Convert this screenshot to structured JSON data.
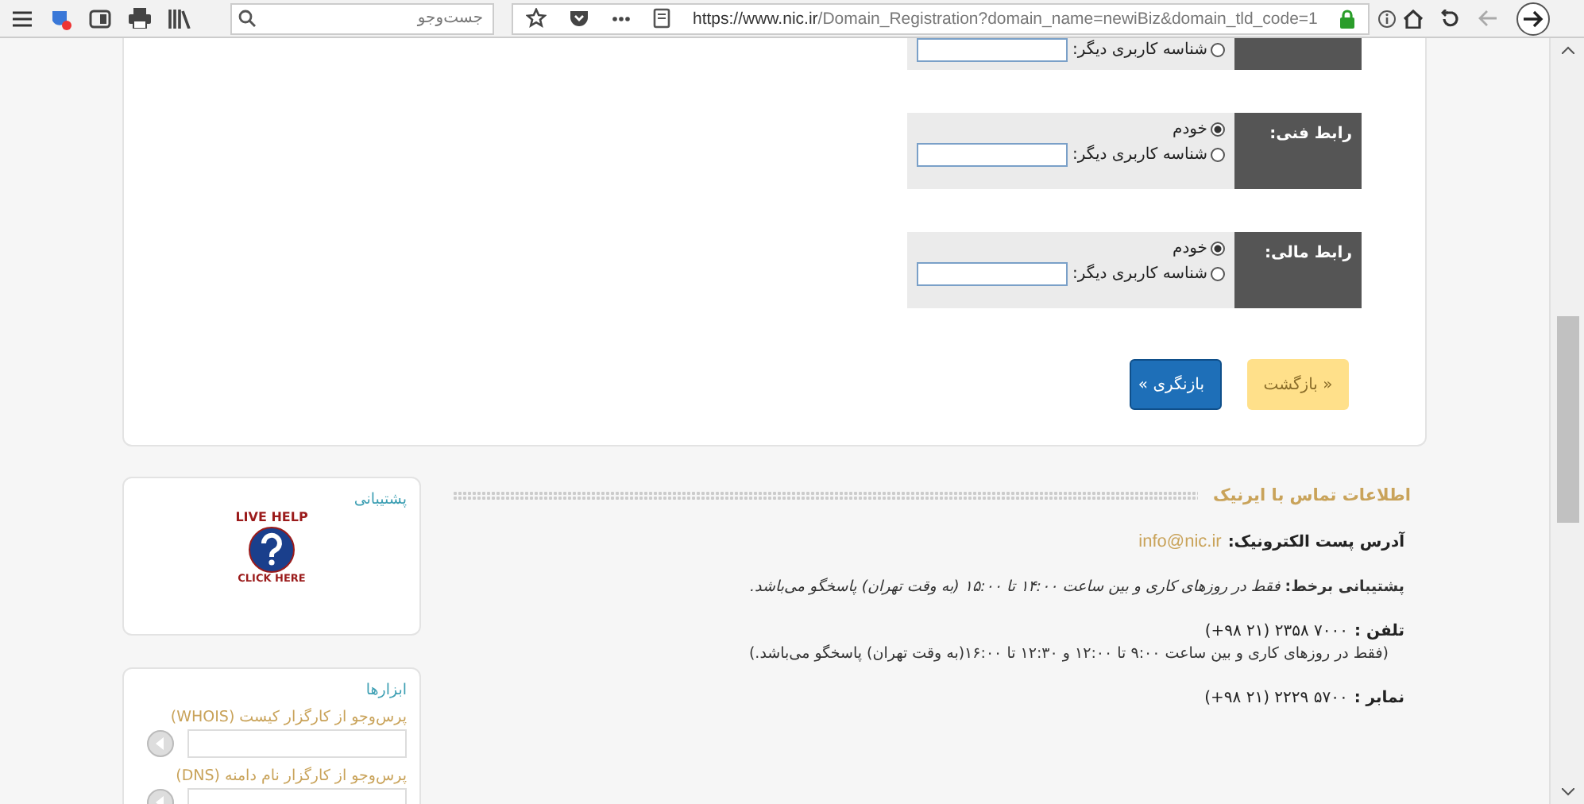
{
  "browser": {
    "search_placeholder": "جست‌وجو",
    "url_host": "https://www.nic.ir",
    "url_path": "/Domain_Registration?domain_name=newiBiz&domain_tld_code=1"
  },
  "contact_groups": [
    {
      "options": [
        {
          "label": "شناسه کاربری دیگر:",
          "selected": false,
          "kind": "field"
        }
      ]
    },
    {
      "label": "رابط فنی:",
      "options": [
        {
          "label": "خودم",
          "selected": true,
          "kind": "plain"
        },
        {
          "label": "شناسه کاربری دیگر:",
          "selected": false,
          "kind": "field"
        }
      ]
    },
    {
      "label": "رابط مالی:",
      "options": [
        {
          "label": "خودم",
          "selected": true,
          "kind": "plain"
        },
        {
          "label": "شناسه کاربری دیگر:",
          "selected": false,
          "kind": "field"
        }
      ]
    }
  ],
  "buttons": [
    {
      "label": "« بازگشت",
      "kind": "back"
    },
    {
      "label": "بازنگری »",
      "kind": "next"
    }
  ],
  "support_card": {
    "title": "پشتیبانی",
    "badge_top": "LIVE HELP",
    "badge_bottom": "CLICK HERE"
  },
  "tools_card": {
    "title": "ابزارها",
    "queries": [
      {
        "label": "پرس‌وجو از کارگزار کیست (WHOIS)"
      },
      {
        "label": "پرس‌وجو از کارگزار نام دامنه (DNS)"
      }
    ]
  },
  "contact_info": {
    "title": "اطلاعات تماس با ایرنیک",
    "email_label": "آدرس پست الکترونیک:",
    "email": "info@nic.ir",
    "support_text": "**پشتیبانی برخط:** *فقط در روزهای کاری و بین ساعت ۱۴:۰۰ تا ۱۵:۰۰ (به وقت تهران) پاسخگو می‌باشد.*",
    "phone_label": "تلفن :",
    "phone": "(+۹۸ ۲۱) ۲۳۵۸ ۷۰۰۰",
    "phone_note": "(فقط در روزهای کاری و بین ساعت ۹:۰۰ تا ۱۲:۰۰ و ۱۲:۳۰ تا ۱۶:۰۰(به وقت تهران) پاسخگو می‌باشد.)",
    "fax_label": "نمابر :",
    "fax": "(+۹۸ ۲۱) ۲۲۲۹ ۵۷۰۰"
  }
}
